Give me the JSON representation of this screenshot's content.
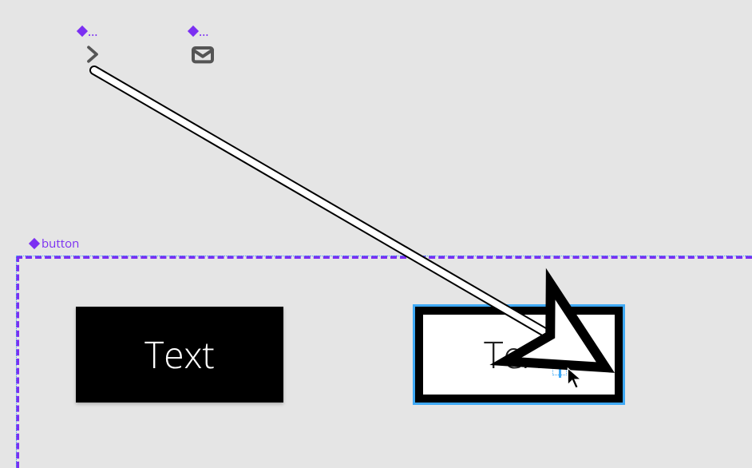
{
  "canvas": {
    "background": "#e5e5e5"
  },
  "top_components": {
    "chevron": {
      "badge": "…"
    },
    "mail": {
      "badge": "…"
    }
  },
  "button_frame": {
    "label": "button",
    "variants": {
      "dark": {
        "label": "Text"
      },
      "light": {
        "label": "Text"
      }
    }
  },
  "colors": {
    "component_purple": "#7b2ff2",
    "selection_blue": "#3fa9f5",
    "icon_gray": "#555555"
  }
}
